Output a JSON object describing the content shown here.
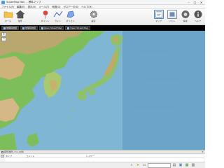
{
  "window": {
    "app_name": "SuperMap Nav",
    "separator": "-",
    "document_name": "標準マップ"
  },
  "menu": [
    "ファイル(F)",
    "編集(E)",
    "表示(V)",
    "ツール(T)",
    "地図(G)",
    "ガスデータ(S)",
    "ヘルプ(H)"
  ],
  "ribbon": {
    "left": [
      "ホーム",
      "住所",
      "ポイント",
      "ライン",
      "ポリゴン",
      "設定"
    ],
    "right": [
      "マップ",
      "リスト",
      "情報",
      "ヘルプ"
    ]
  },
  "map_tabs": [
    "地理院地図",
    "地理院地図",
    "Open Street Map",
    "Open Street Map"
  ],
  "panel": {
    "title": "図形選択リスト(0件)",
    "columns": [
      "タイプ",
      "コメント",
      "レイヤー"
    ]
  },
  "colors": {
    "tab_bar": "#000000",
    "ocean": "#7fb6d4",
    "land_low": "#7dbd5a",
    "land_high": "#c8a46a",
    "accent": "#4aa0d8"
  }
}
